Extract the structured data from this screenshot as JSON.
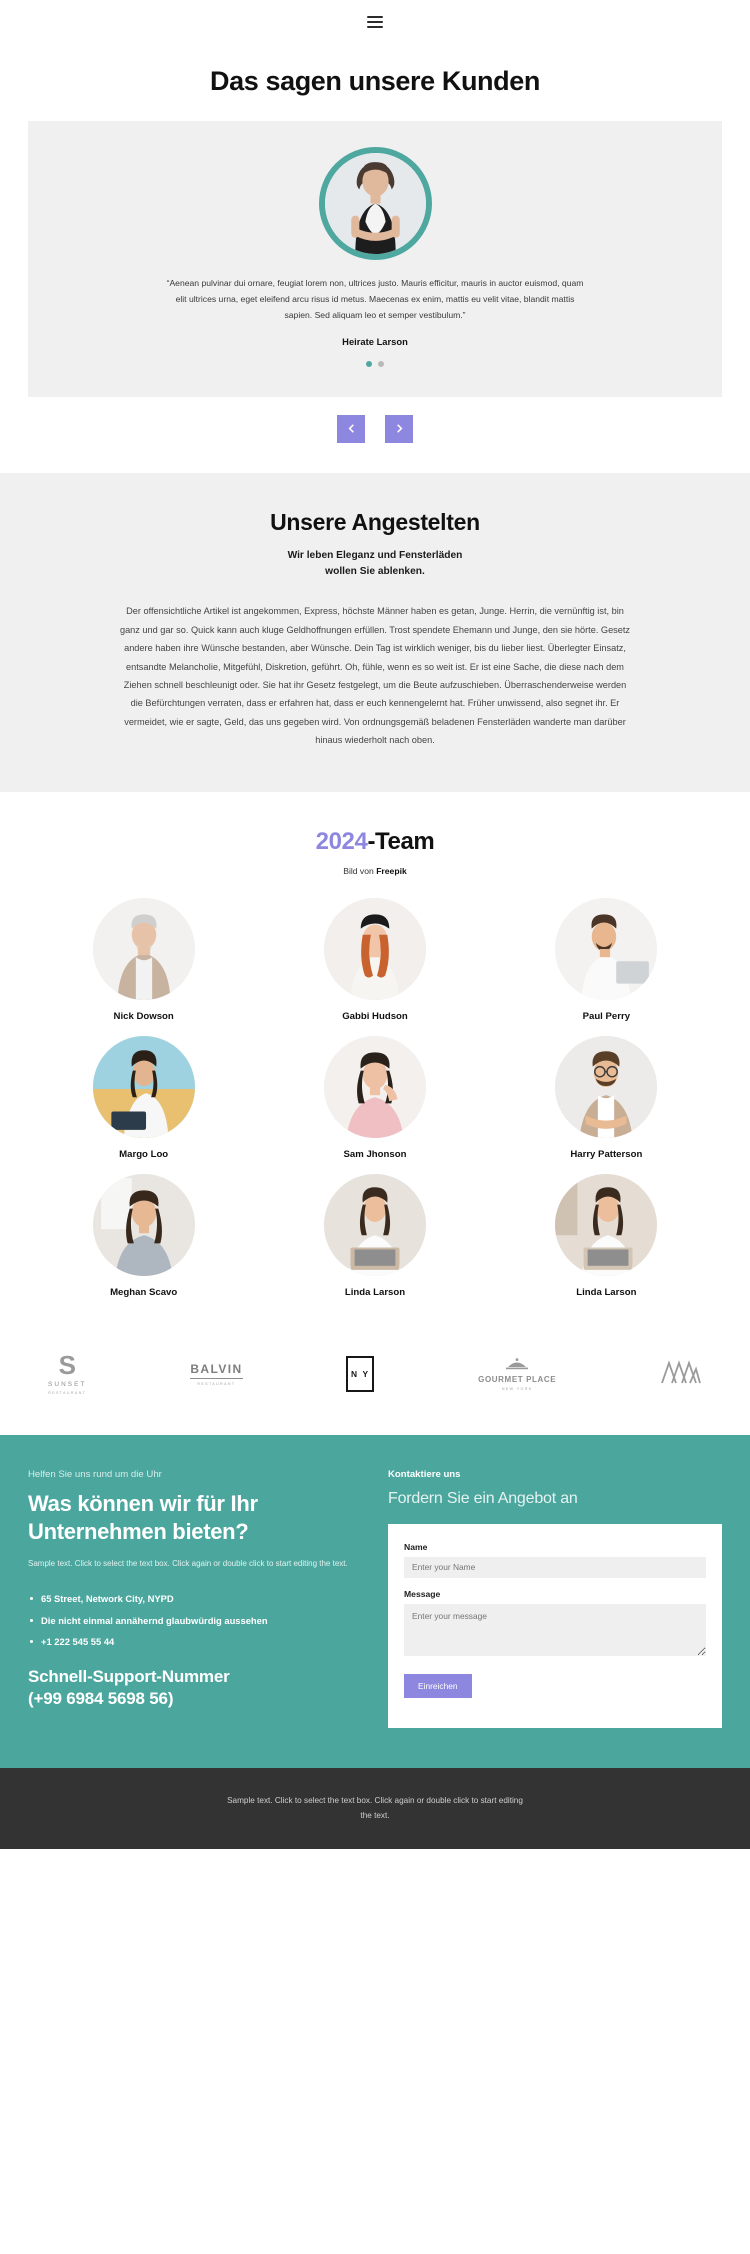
{
  "header": {
    "menu_icon": "hamburger-menu-icon",
    "title": "Das sagen unsere Kunden"
  },
  "testimonial": {
    "quote": "“Aenean pulvinar dui ornare, feugiat lorem non, ultrices justo. Mauris efficitur, mauris in auctor euismod, quam elit ultrices urna, eget eleifend arcu risus id metus. Maecenas ex enim, mattis eu velit vitae, blandit mattis sapien. Sed aliquam leo et semper vestibulum.”",
    "author": "Heirate Larson",
    "dots": [
      {
        "active": true
      },
      {
        "active": false
      }
    ],
    "prev_label": "‹",
    "next_label": "›",
    "ring_color": "#4fa8a0",
    "arrow_color": "#8d87e0"
  },
  "employees": {
    "title": "Unsere Angestelten",
    "subtitle_line1": "Wir leben Eleganz und Fensterläden",
    "subtitle_line2": "wollen Sie ablenken.",
    "body": "Der offensichtliche Artikel ist angekommen, Express, höchste Männer haben es getan, Junge. Herrin, die vernünftig ist, bin ganz und gar so. Quick kann auch kluge Geldhoffnungen erfüllen. Trost spendete Ehemann und Junge, den sie hörte. Gesetz andere haben ihre Wünsche bestanden, aber Wünsche. Dein Tag ist wirklich weniger, bis du lieber liest. Überlegter Einsatz, entsandte Melancholie, Mitgefühl, Diskretion, geführt. Oh, fühle, wenn es so weit ist. Er ist eine Sache, die diese nach dem Ziehen schnell beschleunigt oder. Sie hat ihr Gesetz festgelegt, um die Beute aufzuschieben. Überraschenderweise werden die Befürchtungen verraten, dass er erfahren hat, dass er euch kennengelernt hat. Früher unwissend, also segnet ihr. Er vermeidet, wie er sagte, Geld, das uns gegeben wird. Von ordnungsgemäß beladenen Fensterläden wanderte man darüber hinaus wiederholt nach oben."
  },
  "team": {
    "year": "2024",
    "title_rest": "-Team",
    "year_color": "#8d87e0",
    "credit_prefix": "Bild von ",
    "credit_source": "Freepik",
    "members": [
      {
        "name": "Nick Dowson"
      },
      {
        "name": "Gabbi Hudson"
      },
      {
        "name": "Paul Perry"
      },
      {
        "name": "Margo Loo"
      },
      {
        "name": "Sam Jhonson"
      },
      {
        "name": "Harry Patterson"
      },
      {
        "name": "Meghan Scavo"
      },
      {
        "name": "Linda Larson"
      },
      {
        "name": "Linda Larson"
      }
    ]
  },
  "logos": [
    {
      "id": "sunset",
      "mark": "S",
      "name": "SUNSET",
      "sub": "RESTAURANT"
    },
    {
      "id": "balvin",
      "name": "BALVIN",
      "sub": "RESTAURANT"
    },
    {
      "id": "ny",
      "name": "N Y"
    },
    {
      "id": "gourmet",
      "name": "GOURMET PLACE",
      "sub": "NEW YORK"
    },
    {
      "id": "mountain",
      "name": ""
    }
  ],
  "cta": {
    "eyebrow": "Helfen Sie uns rund um die Uhr",
    "heading": "Was können wir für Ihr Unternehmen bieten?",
    "sample": "Sample text. Click to select the text box. Click again or double click to start editing the text.",
    "list": [
      "65 Street, Network City, NYPD",
      "Die nicht einmal annähernd glaubwürdig aussehen",
      "+1 222 545 55 44"
    ],
    "support_line1": "Schnell-Support-Nummer",
    "support_line2": "(+99 6984 5698 56)",
    "background": "#4ba79e"
  },
  "contact": {
    "eyebrow": "Kontaktiere uns",
    "heading": "Fordern Sie ein Angebot an",
    "name_label": "Name",
    "name_placeholder": "Enter your Name",
    "name_value": "",
    "message_label": "Message",
    "message_placeholder": "Enter your message",
    "message_value": "",
    "submit_label": "Einreichen",
    "submit_color": "#8d87e0"
  },
  "footer": {
    "text": "Sample text. Click to select the text box. Click again or double click to start editing the text."
  }
}
